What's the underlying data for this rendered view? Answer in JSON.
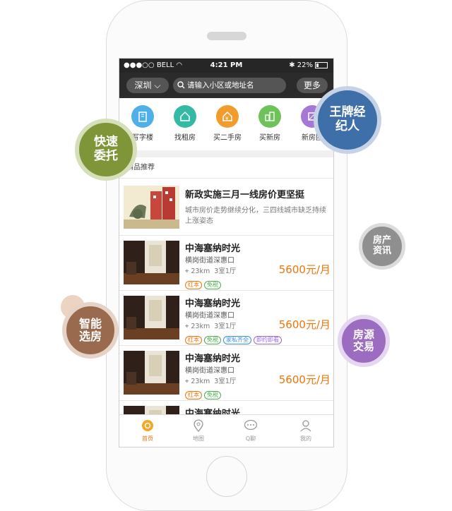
{
  "status_bar": {
    "carrier": "BELL",
    "time": "4:21 PM",
    "battery": "22%"
  },
  "nav": {
    "city": "深圳",
    "search_placeholder": "请输入小区或地址名",
    "more_label": "更多"
  },
  "categories": [
    {
      "label": "写字楼",
      "color": "#4fb0e8",
      "icon": "office-building-icon"
    },
    {
      "label": "找租房",
      "color": "#34b9a4",
      "icon": "house-icon"
    },
    {
      "label": "买二手房",
      "color": "#f39c2e",
      "icon": "money-house-icon"
    },
    {
      "label": "买新房",
      "color": "#6fc25a",
      "icon": "new-house-icon"
    },
    {
      "label": "新房团",
      "color": "#a678d6",
      "icon": "group-house-icon"
    }
  ],
  "section_title": "精品推荐",
  "news": {
    "title": "新政实施三月一线房价更坚挺",
    "desc": "城市房价走势继续分化，三四线城市缺乏持续上涨姿态"
  },
  "listings": [
    {
      "name": "中海塞纳时光",
      "addr": "横岗街道深惠口",
      "distance": "23km",
      "layout": "3室1厅",
      "price": "5600元/月",
      "tags": [
        {
          "text": "红本",
          "color": "#f0740b"
        },
        {
          "text": "免税",
          "color": "#4caf50"
        }
      ]
    },
    {
      "name": "中海塞纳时光",
      "addr": "横岗街道深惠口",
      "distance": "23km",
      "layout": "3室1厅",
      "price": "5600元/月",
      "tags": [
        {
          "text": "红本",
          "color": "#f0740b"
        },
        {
          "text": "免税",
          "color": "#4caf50"
        },
        {
          "text": "家私齐全",
          "color": "#3a8ee6"
        },
        {
          "text": "即约即看",
          "color": "#9b6bd1"
        }
      ]
    },
    {
      "name": "中海塞纳时光",
      "addr": "横岗街道深惠口",
      "distance": "23km",
      "layout": "3室1厅",
      "price": "5600元/月",
      "tags": [
        {
          "text": "红本",
          "color": "#f0740b"
        },
        {
          "text": "免税",
          "color": "#4caf50"
        }
      ]
    },
    {
      "name": "中海塞纳时光"
    }
  ],
  "tabs": [
    {
      "label": "首页",
      "icon": "home-icon",
      "active": true
    },
    {
      "label": "地图",
      "icon": "map-pin-icon",
      "active": false
    },
    {
      "label": "Q聊",
      "icon": "chat-icon",
      "active": false
    },
    {
      "label": "我的",
      "icon": "user-icon",
      "active": false
    }
  ],
  "bubbles": {
    "agent": "王牌经纪人",
    "entrust": "快速委托",
    "news": "房产资讯",
    "smart": "智能选房",
    "trade": "房源交易"
  },
  "colors": {
    "accent": "#f0740b",
    "nav_bg": "#2b2b2b"
  }
}
